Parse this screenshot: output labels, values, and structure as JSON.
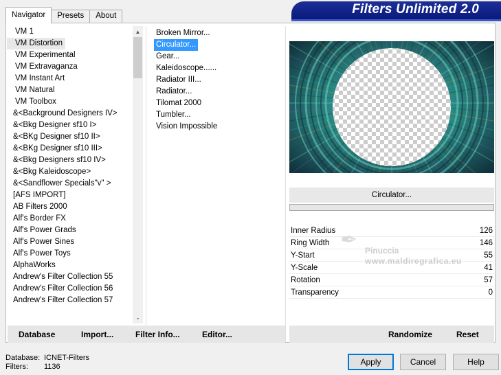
{
  "tabs": [
    "Navigator",
    "Presets",
    "About"
  ],
  "banner_title": "Filters Unlimited 2.0",
  "categories": [
    "VM 1",
    "VM Distortion",
    "VM Experimental",
    "VM Extravaganza",
    "VM Instant Art",
    "VM Natural",
    "VM Toolbox",
    "&<Background Designers IV>",
    "&<Bkg Designer sf10 I>",
    "&<BKg Designer sf10 II>",
    "&<BKg Designer sf10 III>",
    "&<Bkg Designers sf10 IV>",
    "&<Bkg Kaleidoscope>",
    "&<Sandflower Specials\"v\" >",
    "[AFS IMPORT]",
    "AB Filters 2000",
    "Alf's Border FX",
    "Alf's Power Grads",
    "Alf's Power Sines",
    "Alf's Power Toys",
    "AlphaWorks",
    "Andrew's Filter Collection 55",
    "Andrew's Filter Collection 56",
    "Andrew's Filter Collection 57"
  ],
  "filters": [
    "Broken Mirror...",
    "Circulator...",
    "Gear...",
    "Kaleidoscope......",
    "Radiator III...",
    "Radiator...",
    "Tilomat 2000",
    "Tumbler...",
    "Vision Impossible"
  ],
  "left_toolbar": {
    "database": "Database",
    "import": "Import...",
    "filter_info": "Filter Info...",
    "editor": "Editor..."
  },
  "filter_name": "Circulator...",
  "params": [
    {
      "label": "Inner Radius",
      "value": "126"
    },
    {
      "label": "Ring Width",
      "value": "146"
    },
    {
      "label": "Y-Start",
      "value": "55"
    },
    {
      "label": "Y-Scale",
      "value": "41"
    },
    {
      "label": "Rotation",
      "value": "57"
    },
    {
      "label": "Transparency",
      "value": "0"
    }
  ],
  "right_toolbar": {
    "randomize": "Randomize",
    "reset": "Reset"
  },
  "footer": {
    "database_label": "Database:",
    "database_value": "ICNET-Filters",
    "filters_label": "Filters:",
    "filters_value": "1136"
  },
  "buttons": {
    "apply": "Apply",
    "cancel": "Cancel",
    "help": "Help"
  },
  "watermark": {
    "brand": "Pinuccia",
    "site": "www.maldiregrafica.eu"
  }
}
